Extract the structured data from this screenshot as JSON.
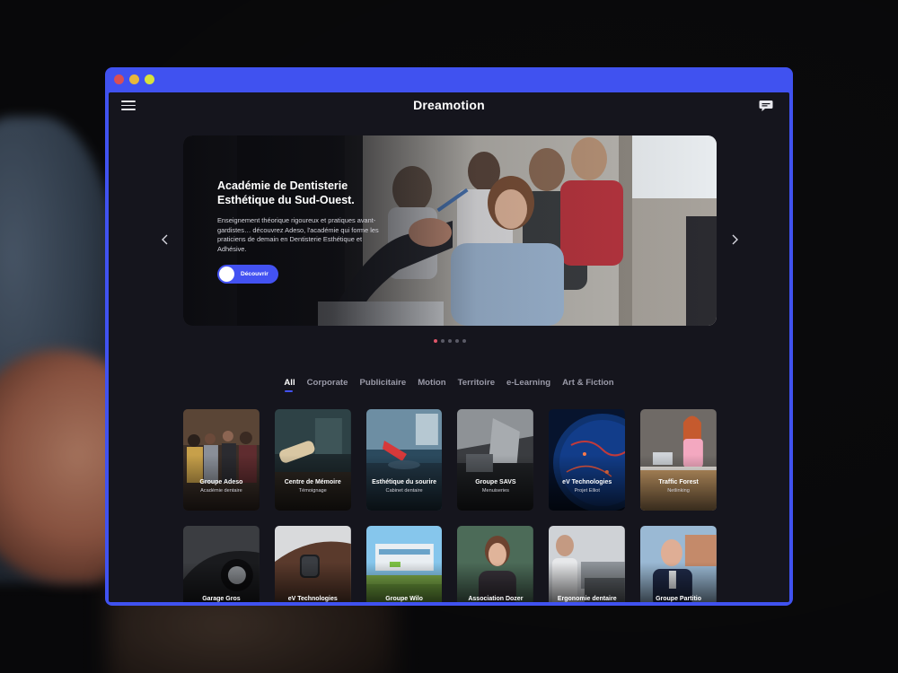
{
  "app": {
    "brand": "Dreamotion",
    "icons": {
      "menu": "hamburger-menu-icon",
      "chat": "chat-bubble-icon"
    },
    "accent_color": "#4352f2"
  },
  "hero": {
    "title": "Académie de Dentisterie Esthétique du Sud-Ouest.",
    "description": "Enseignement théorique rigoureux et pratiques avant-gardistes… découvrez Adeso, l'académie qui forme les praticiens de demain en Dentisterie Esthétique et Adhésive.",
    "cta_label": "Découvrir",
    "slide_count": 5,
    "active_slide": 1
  },
  "filters": [
    {
      "label": "All",
      "active": true
    },
    {
      "label": "Corporate",
      "active": false
    },
    {
      "label": "Publicitaire",
      "active": false
    },
    {
      "label": "Motion",
      "active": false
    },
    {
      "label": "Territoire",
      "active": false
    },
    {
      "label": "e-Learning",
      "active": false
    },
    {
      "label": "Art & Fiction",
      "active": false
    }
  ],
  "projects_row1": [
    {
      "title": "Groupe Adeso",
      "subtitle": "Académie dentaire"
    },
    {
      "title": "Centre de Mémoire",
      "subtitle": "Témoignage"
    },
    {
      "title": "Esthétique du sourire",
      "subtitle": "Cabinet dentaire"
    },
    {
      "title": "Groupe SAVS",
      "subtitle": "Menuiseries"
    },
    {
      "title": "eV Technologies",
      "subtitle": "Projet Elliot"
    },
    {
      "title": "Traffic Forest",
      "subtitle": "Netlinking"
    }
  ],
  "projects_row2": [
    {
      "title": "Garage Gros"
    },
    {
      "title": "eV Technologies"
    },
    {
      "title": "Groupe Wilo"
    },
    {
      "title": "Association Dozer"
    },
    {
      "title": "Ergonomie dentaire"
    },
    {
      "title": "Groupe Partitio"
    }
  ]
}
